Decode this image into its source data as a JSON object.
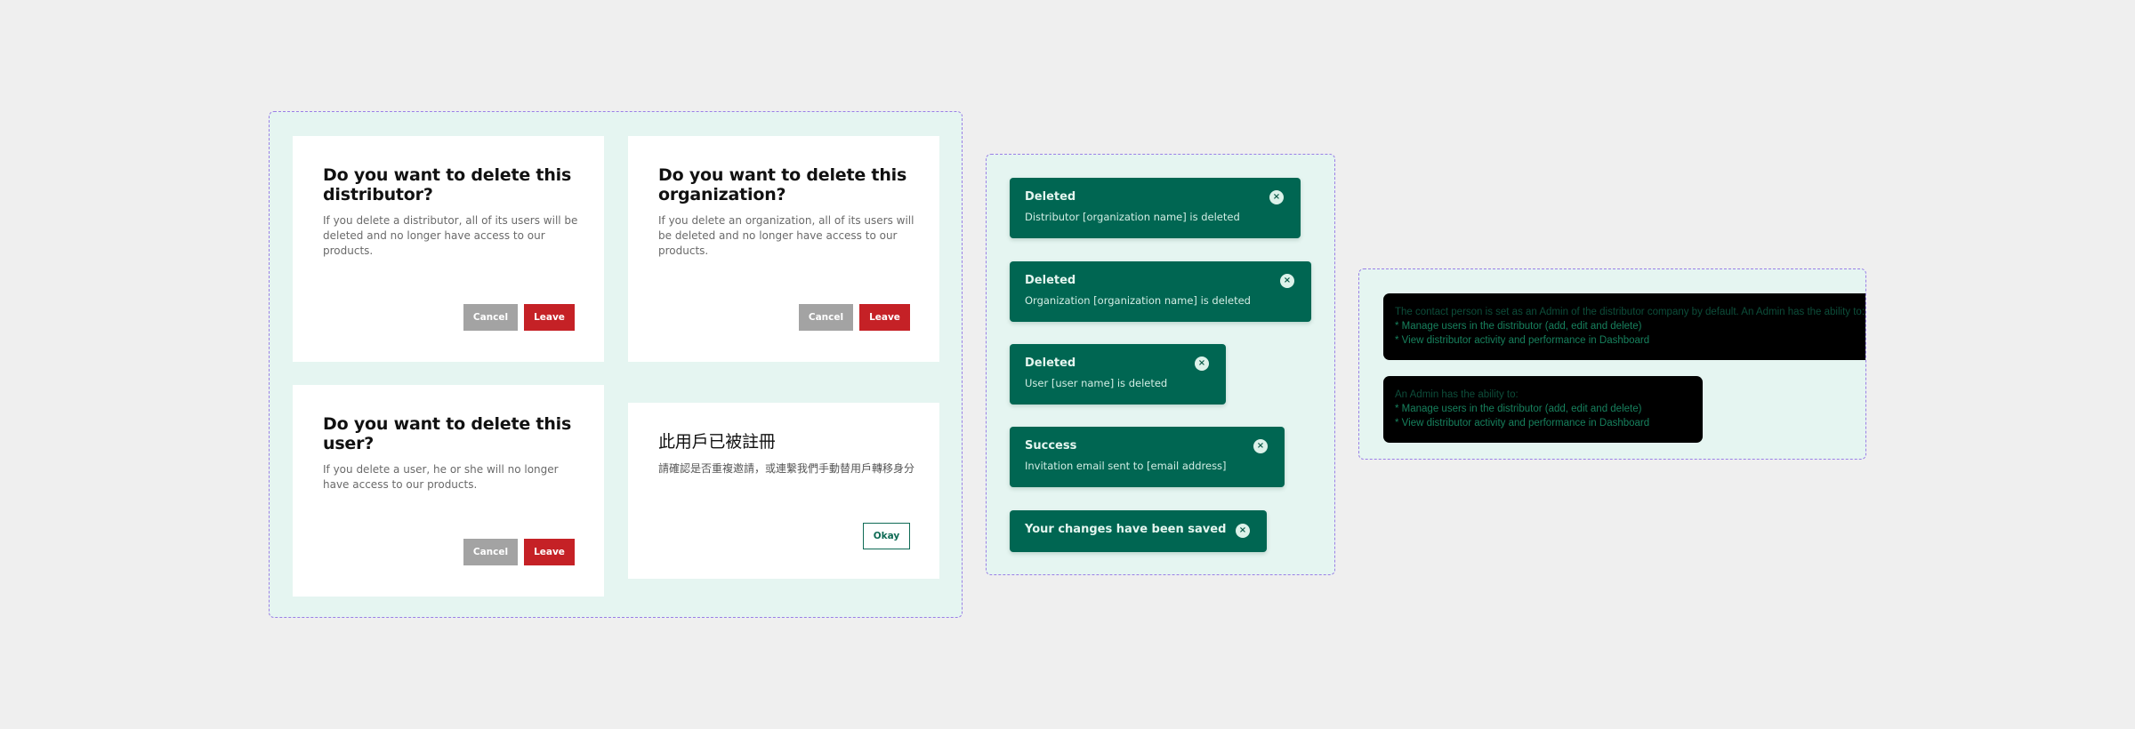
{
  "colors": {
    "frame_bg": "#e5f5f1",
    "frame_border": "#9b7fe6",
    "toast_bg": "#006652",
    "leave_button": "#c52126",
    "cancel_button": "#a3a3a3",
    "okay_border": "#0f6b55",
    "tooltip_bg": "#000000"
  },
  "dialogs": [
    {
      "title": "Do you want to delete this distributor?",
      "body": "If you delete a distributor, all of its users will be deleted and no longer have access to our products.",
      "cancel_label": "Cancel",
      "leave_label": "Leave"
    },
    {
      "title": "Do you want to delete this organization?",
      "body": "If you delete an organization, all of its users will be deleted and no longer have access to our products.",
      "cancel_label": "Cancel",
      "leave_label": "Leave"
    },
    {
      "title": "Do you want to delete this user?",
      "body": "If you delete a user, he or she will no longer have access to our products.",
      "cancel_label": "Cancel",
      "leave_label": "Leave"
    },
    {
      "title": "此用戶已被註冊",
      "body": "請確認是否重複邀請，或連繫我們手動替用戶轉移身分",
      "okay_label": "Okay"
    }
  ],
  "toasts": [
    {
      "title": "Deleted",
      "message": "Distributor [organization name] is deleted",
      "close_icon": "×"
    },
    {
      "title": "Deleted",
      "message": "Organization [organization name] is deleted",
      "close_icon": "×"
    },
    {
      "title": "Deleted",
      "message": "User [user name] is deleted",
      "close_icon": "×"
    },
    {
      "title": "Success",
      "message": "Invitation email sent to [email address]",
      "close_icon": "×"
    },
    {
      "title": "Your changes have been saved",
      "close_icon": "×"
    }
  ],
  "tooltips": [
    {
      "intro": "The contact person is set as an Admin of the distributor company by default. An Admin has the ability to:",
      "bullets": [
        "* Manage users in the distributor (add, edit and delete)",
        "* View distributor activity and performance in Dashboard"
      ]
    },
    {
      "intro": "An Admin has the ability to:",
      "bullets": [
        "* Manage users in the distributor (add, edit and delete)",
        "* View distributor activity and performance in Dashboard"
      ]
    }
  ]
}
